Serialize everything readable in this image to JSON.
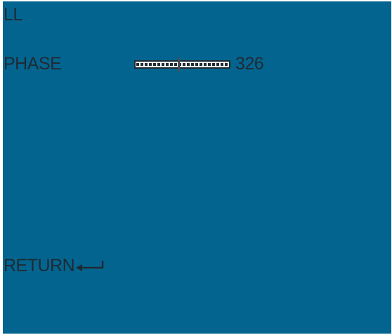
{
  "menu": {
    "title": "LL",
    "phase": {
      "label": "PHASE",
      "value": "326",
      "level": 0.46
    },
    "return_label": "RETURN"
  },
  "icons": {
    "return": "enter-arrow-icon"
  },
  "colors": {
    "background": "#03658f",
    "text": "#1f2a33",
    "slider_fill": "#ffffff"
  }
}
